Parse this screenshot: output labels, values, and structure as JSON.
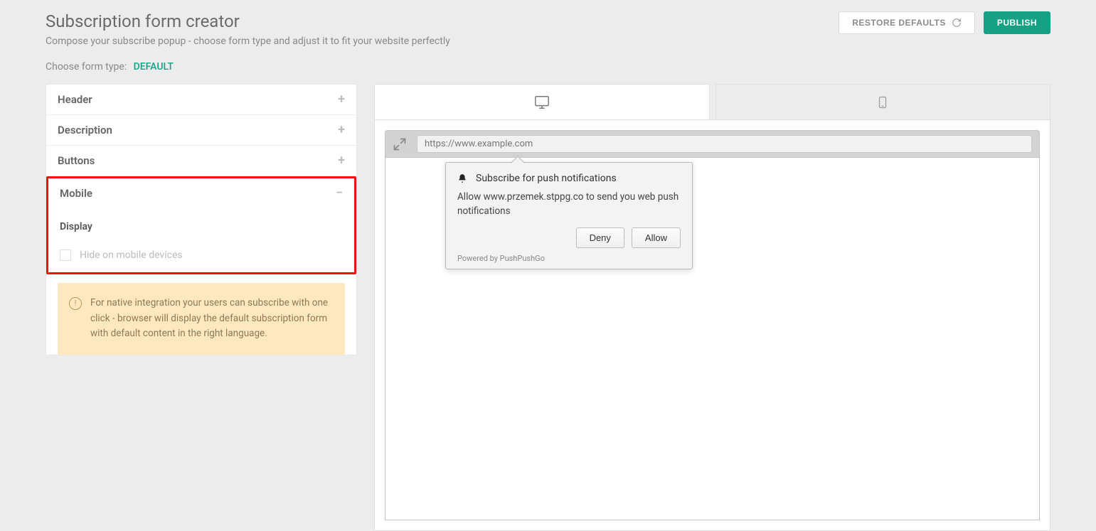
{
  "header": {
    "title": "Subscription form creator",
    "subtitle": "Compose your subscribe popup - choose form type and adjust it to fit your website perfectly",
    "restore_label": "RESTORE DEFAULTS",
    "publish_label": "PUBLISH"
  },
  "form_type": {
    "label": "Choose form type:",
    "value": "DEFAULT"
  },
  "accordion": {
    "header": "Header",
    "description": "Description",
    "buttons": "Buttons",
    "mobile": "Mobile",
    "mobile_section": {
      "display_label": "Display",
      "hide_label": "Hide on mobile devices"
    }
  },
  "info_banner": "For native integration your users can subscribe with one click - browser will display the default subscription form with default content in the right language.",
  "preview": {
    "url": "https://www.example.com",
    "notif_title": "Subscribe for push notifications",
    "notif_body": "Allow www.przemek.stppg.co to send you web push notifications",
    "deny": "Deny",
    "allow": "Allow",
    "powered": "Powered by PushPushGo"
  }
}
